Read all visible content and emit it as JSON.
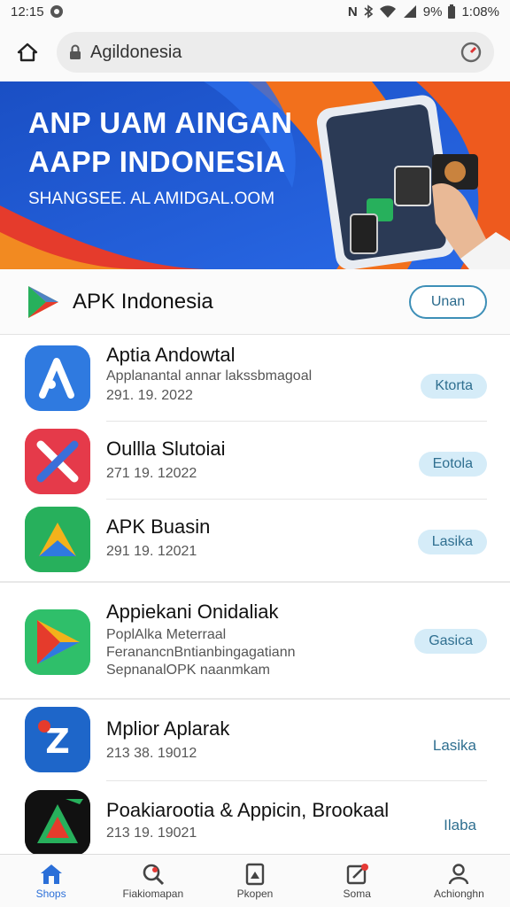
{
  "status_bar": {
    "time": "12:15",
    "battery_text": "9%",
    "clock_right": "1:08%"
  },
  "address_bar": {
    "url": "Agildonesia"
  },
  "banner": {
    "title_line1": "ANP UAM AINGAN",
    "title_line2": "AAPP INDONESIA",
    "subtitle": "SHANGSEE. AL AMIDGAL.OOM"
  },
  "section": {
    "title": "APK Indonesia",
    "button_label": "Unan"
  },
  "apps": [
    {
      "name": "Aptia Andowtal",
      "desc": [
        "Applanantal annar lakssbmagoal"
      ],
      "date": "291. 19. 2022",
      "action": "Ktorta",
      "action_style": "pill",
      "icon": "apk-a-icon",
      "color": "#2f7ae0"
    },
    {
      "name": "Oullla Slutoiai",
      "desc": [],
      "date": "271 19. 12022",
      "action": "Eotola",
      "action_style": "pill",
      "icon": "apk-x-icon",
      "color": "#e53a4a"
    },
    {
      "name": "APK Buasin",
      "desc": [],
      "date": "291 19. 12021",
      "action": "Lasika",
      "action_style": "pill",
      "icon": "apk-triangle-icon",
      "color": "#27b05c"
    },
    {
      "name": "Appiekani Onidaliak",
      "desc": [
        "PoplAlka Meterraal",
        "FeranancnBntianbingagatiann",
        "SepnanalOPK naanmkam"
      ],
      "date": "",
      "action": "Gasica",
      "action_style": "pill",
      "icon": "apk-play-icon",
      "color": "#2fbf6a"
    },
    {
      "name": "Mplior Aplarak",
      "desc": [],
      "date": "213 38. 19012",
      "action": "Lasika",
      "action_style": "link",
      "icon": "apk-z-icon",
      "color": "#1e66c9"
    },
    {
      "name": "Poakiarootia & Appicin, Brookaal",
      "desc": [],
      "date": "213 19. 19021",
      "action": "Ilaba",
      "action_style": "link",
      "icon": "apk-delta-icon",
      "color": "#111111"
    }
  ],
  "bottom_nav": [
    {
      "label": "Shops",
      "icon": "home-icon",
      "active": true
    },
    {
      "label": "Fiakiomapan",
      "icon": "search-icon",
      "active": false
    },
    {
      "label": "Pkopen",
      "icon": "book-icon",
      "active": false
    },
    {
      "label": "Soma",
      "icon": "edit-icon",
      "active": false,
      "badge": true
    },
    {
      "label": "Achionghn",
      "icon": "person-icon",
      "active": false
    }
  ]
}
